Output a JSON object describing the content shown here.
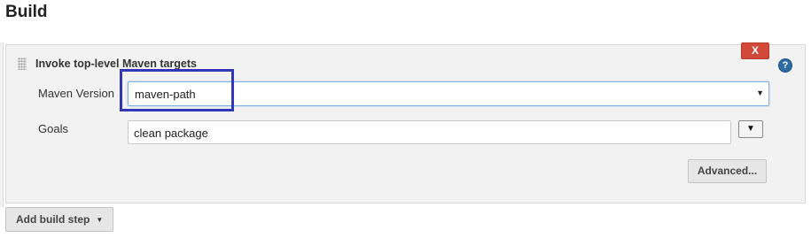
{
  "section": {
    "title": "Build"
  },
  "build_step": {
    "title": "Invoke top-level Maven targets",
    "delete_label": "X",
    "help_label": "?",
    "maven_version": {
      "label": "Maven Version",
      "selected": "maven-path",
      "arrow": "▼"
    },
    "goals": {
      "label": "Goals",
      "value": "clean package",
      "expand_arrow": "▼"
    },
    "advanced_label": "Advanced..."
  },
  "add_build_step": {
    "label": "Add build step",
    "caret": "▼"
  },
  "colors": {
    "delete_button": "#d24939",
    "highlight_border": "#3237b8",
    "help_icon": "#2f6ca5"
  }
}
